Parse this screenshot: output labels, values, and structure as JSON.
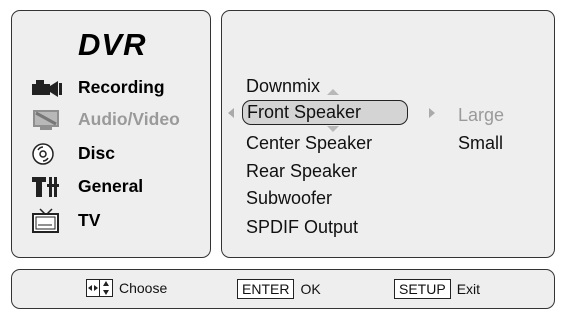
{
  "left_panel": {
    "title": "DVR",
    "categories": [
      {
        "label": "Recording",
        "icon": "camcorder-icon",
        "enabled": true
      },
      {
        "label": "Audio/Video",
        "icon": "audio-video-icon",
        "enabled": false
      },
      {
        "label": "Disc",
        "icon": "disc-icon",
        "enabled": true
      },
      {
        "label": "General",
        "icon": "general-settings-icon",
        "enabled": true
      },
      {
        "label": "TV",
        "icon": "tv-icon",
        "enabled": true
      }
    ]
  },
  "right_panel": {
    "menu_items": [
      "Downmix",
      "Front Speaker",
      "Center Speaker",
      "Rear Speaker",
      "Subwoofer",
      "SPDIF Output"
    ],
    "selected_item": "Front Speaker",
    "options": [
      {
        "label": "Large",
        "active": false
      },
      {
        "label": "Small",
        "active": true
      }
    ]
  },
  "bottom_bar": {
    "choose_label": "Choose",
    "enter_key": "ENTER",
    "enter_label": "OK",
    "setup_key": "SETUP",
    "setup_label": "Exit"
  },
  "colors": {
    "panel_bg": "#eeeeee",
    "panel_border": "#333333",
    "selected_bg": "#d4d4d4",
    "disabled_text": "#9a9a9a"
  }
}
